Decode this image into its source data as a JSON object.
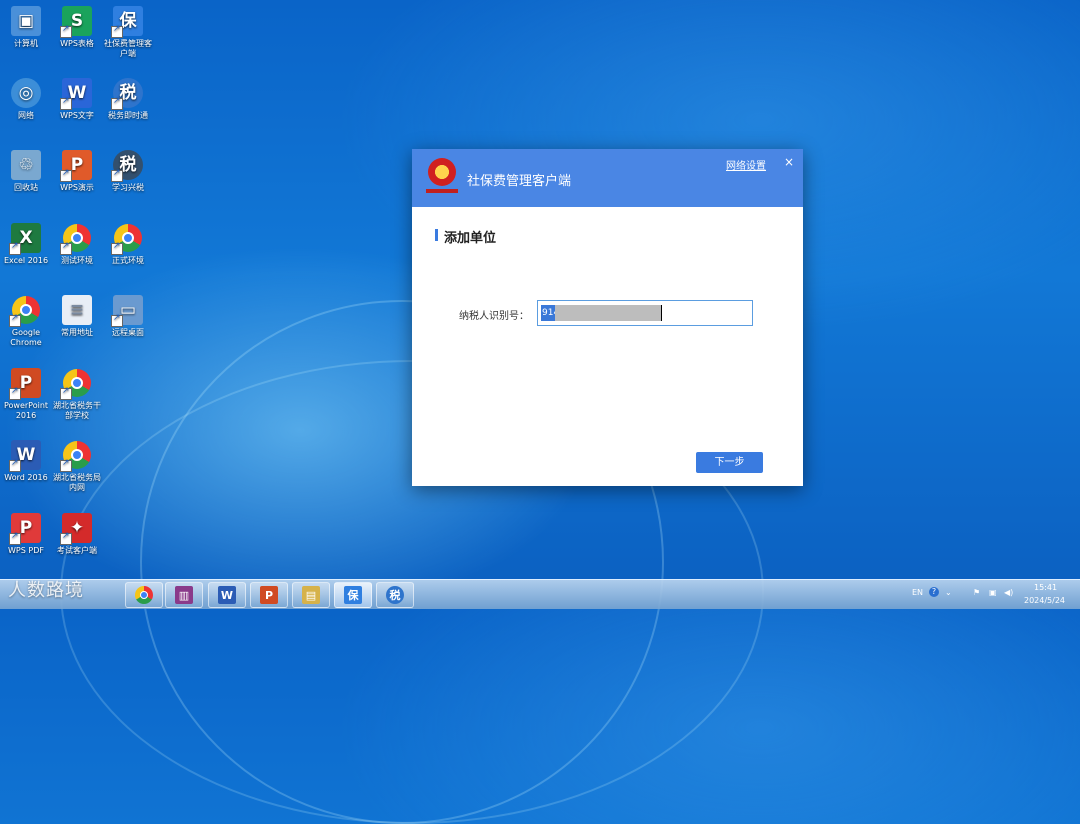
{
  "desktop": {
    "icons": [
      {
        "label": "计算机",
        "glyph": "▣",
        "color": "#4a90d9"
      },
      {
        "label": "WPS表格",
        "glyph": "S",
        "color": "#1aa35c"
      },
      {
        "label": "社保费管理客户端",
        "glyph": "保",
        "color": "#2f7fe0"
      },
      {
        "label": "网络",
        "glyph": "◎",
        "color": "#3c8ed8"
      },
      {
        "label": "WPS文字",
        "glyph": "W",
        "color": "#2a66d8"
      },
      {
        "label": "税务即时通",
        "glyph": "税",
        "color": "#2e74cc"
      },
      {
        "label": "回收站",
        "glyph": "♲",
        "color": "#7aa8d0"
      },
      {
        "label": "WPS演示",
        "glyph": "P",
        "color": "#e05a2a"
      },
      {
        "label": "学习兴税",
        "glyph": "税",
        "color": "#33506e"
      },
      {
        "label": "Excel 2016",
        "glyph": "X",
        "color": "#1e7a40"
      },
      {
        "label": "测试环境",
        "glyph": "",
        "color": ""
      },
      {
        "label": "正式环境",
        "glyph": "",
        "color": ""
      },
      {
        "label": "Google Chrome",
        "glyph": "",
        "color": ""
      },
      {
        "label": "常用地址",
        "glyph": "≡",
        "color": "#e8eef6"
      },
      {
        "label": "远程桌面",
        "glyph": "▭",
        "color": "#6a9ad0"
      },
      {
        "label": "PowerPoint 2016",
        "glyph": "P",
        "color": "#d04a22"
      },
      {
        "label": "湖北省税务干部学校",
        "glyph": "",
        "color": ""
      },
      {
        "label": "Word 2016",
        "glyph": "W",
        "color": "#2b5cb5"
      },
      {
        "label": "湖北省税务局内网",
        "glyph": "",
        "color": ""
      },
      {
        "label": "WPS PDF",
        "glyph": "P",
        "color": "#e03a3a"
      },
      {
        "label": "考试客户端",
        "glyph": "✦",
        "color": "#d42a2a"
      }
    ]
  },
  "dialog": {
    "title": "社保费管理客户端",
    "network_settings": "网络设置",
    "close_glyph": "×",
    "section_title": "添加单位",
    "taxpayer_label": "纳税人识别号：",
    "taxpayer_value": "914",
    "next_button": "下一步"
  },
  "watermark": "人数路境",
  "taskbar": {
    "apps": [
      {
        "name": "chrome"
      },
      {
        "name": "winrar",
        "glyph": "▥",
        "color": "#8a3a8a"
      },
      {
        "name": "word",
        "glyph": "W",
        "color": "#2b5cb5"
      },
      {
        "name": "powerpoint",
        "glyph": "P",
        "color": "#d04a22"
      },
      {
        "name": "folder",
        "glyph": "▤",
        "color": "#d6b24a"
      },
      {
        "name": "社保费",
        "glyph": "保",
        "color": "#2f7fe0"
      },
      {
        "name": "税务即时通",
        "glyph": "税",
        "color": "#2e74cc"
      }
    ],
    "tray": {
      "lang": "EN",
      "help": "?"
    },
    "clock": {
      "time": "15:41",
      "date": "2024/5/24"
    }
  },
  "colors": {
    "dialog_header": "#4a86e4",
    "accent": "#3a7be0"
  }
}
